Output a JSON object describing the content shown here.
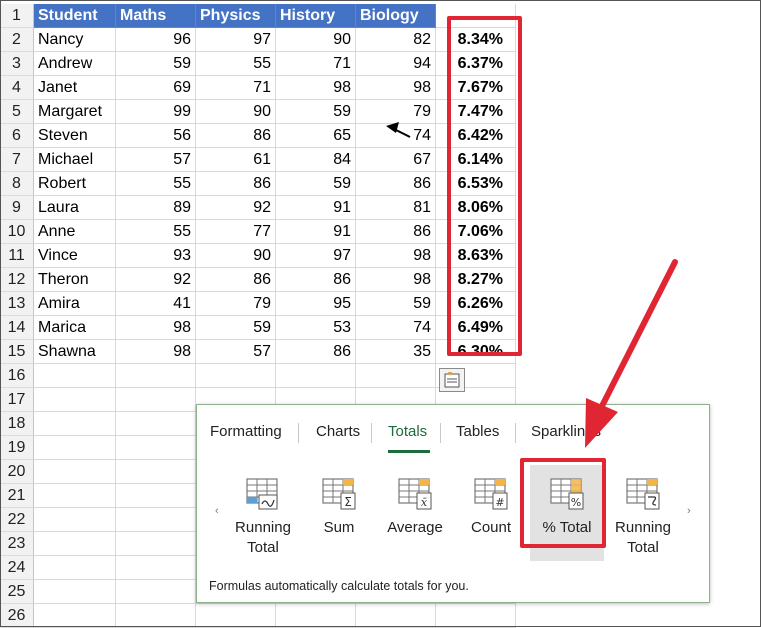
{
  "sheet": {
    "headers": [
      "Student",
      "Maths",
      "Physics",
      "History",
      "Biology"
    ],
    "rows": [
      {
        "name": "Nancy",
        "maths": "96",
        "physics": "97",
        "history": "90",
        "biology": "82",
        "pct": "8.34%"
      },
      {
        "name": "Andrew",
        "maths": "59",
        "physics": "55",
        "history": "71",
        "biology": "94",
        "pct": "6.37%"
      },
      {
        "name": "Janet",
        "maths": "69",
        "physics": "71",
        "history": "98",
        "biology": "98",
        "pct": "7.67%"
      },
      {
        "name": "Margaret",
        "maths": "99",
        "physics": "90",
        "history": "59",
        "biology": "79",
        "pct": "7.47%"
      },
      {
        "name": "Steven",
        "maths": "56",
        "physics": "86",
        "history": "65",
        "biology": "74",
        "pct": "6.42%"
      },
      {
        "name": "Michael",
        "maths": "57",
        "physics": "61",
        "history": "84",
        "biology": "67",
        "pct": "6.14%"
      },
      {
        "name": "Robert",
        "maths": "55",
        "physics": "86",
        "history": "59",
        "biology": "86",
        "pct": "6.53%"
      },
      {
        "name": "Laura",
        "maths": "89",
        "physics": "92",
        "history": "91",
        "biology": "81",
        "pct": "8.06%"
      },
      {
        "name": "Anne",
        "maths": "55",
        "physics": "77",
        "history": "91",
        "biology": "86",
        "pct": "7.06%"
      },
      {
        "name": "Vince",
        "maths": "93",
        "physics": "90",
        "history": "97",
        "biology": "98",
        "pct": "8.63%"
      },
      {
        "name": "Theron",
        "maths": "92",
        "physics": "86",
        "history": "86",
        "biology": "98",
        "pct": "8.27%"
      },
      {
        "name": "Amira",
        "maths": "41",
        "physics": "79",
        "history": "95",
        "biology": "59",
        "pct": "6.26%"
      },
      {
        "name": "Marica",
        "maths": "98",
        "physics": "59",
        "history": "53",
        "biology": "74",
        "pct": "6.49%"
      },
      {
        "name": "Shawna",
        "maths": "98",
        "physics": "57",
        "history": "86",
        "biology": "35",
        "pct": "6.30%"
      }
    ],
    "row_numbers": [
      "1",
      "2",
      "3",
      "4",
      "5",
      "6",
      "7",
      "8",
      "9",
      "10",
      "11",
      "12",
      "13",
      "14",
      "15",
      "16",
      "17",
      "18",
      "19",
      "20",
      "21",
      "22",
      "23",
      "24",
      "25",
      "26"
    ]
  },
  "quick_analysis": {
    "tabs": [
      "Formatting",
      "Charts",
      "Totals",
      "Tables",
      "Sparklines"
    ],
    "active_tab": "Totals",
    "tools": [
      {
        "label_line1": "Running",
        "label_line2": "Total",
        "icon": "running-total-rows-icon"
      },
      {
        "label_line1": "Sum",
        "label_line2": "",
        "icon": "sum-icon"
      },
      {
        "label_line1": "Average",
        "label_line2": "",
        "icon": "average-icon"
      },
      {
        "label_line1": "Count",
        "label_line2": "",
        "icon": "count-icon"
      },
      {
        "label_line1": "% Total",
        "label_line2": "",
        "icon": "percent-total-icon"
      },
      {
        "label_line1": "Running",
        "label_line2": "Total",
        "icon": "running-total-columns-icon"
      }
    ],
    "selected_tool": "% Total",
    "footer": "Formulas automatically calculate totals for you.",
    "prev_glyph": "‹",
    "next_glyph": "›"
  },
  "colors": {
    "header_fill": "#4472c4",
    "annotation_red": "#e02633",
    "active_tab_green": "#1e6b3b"
  }
}
